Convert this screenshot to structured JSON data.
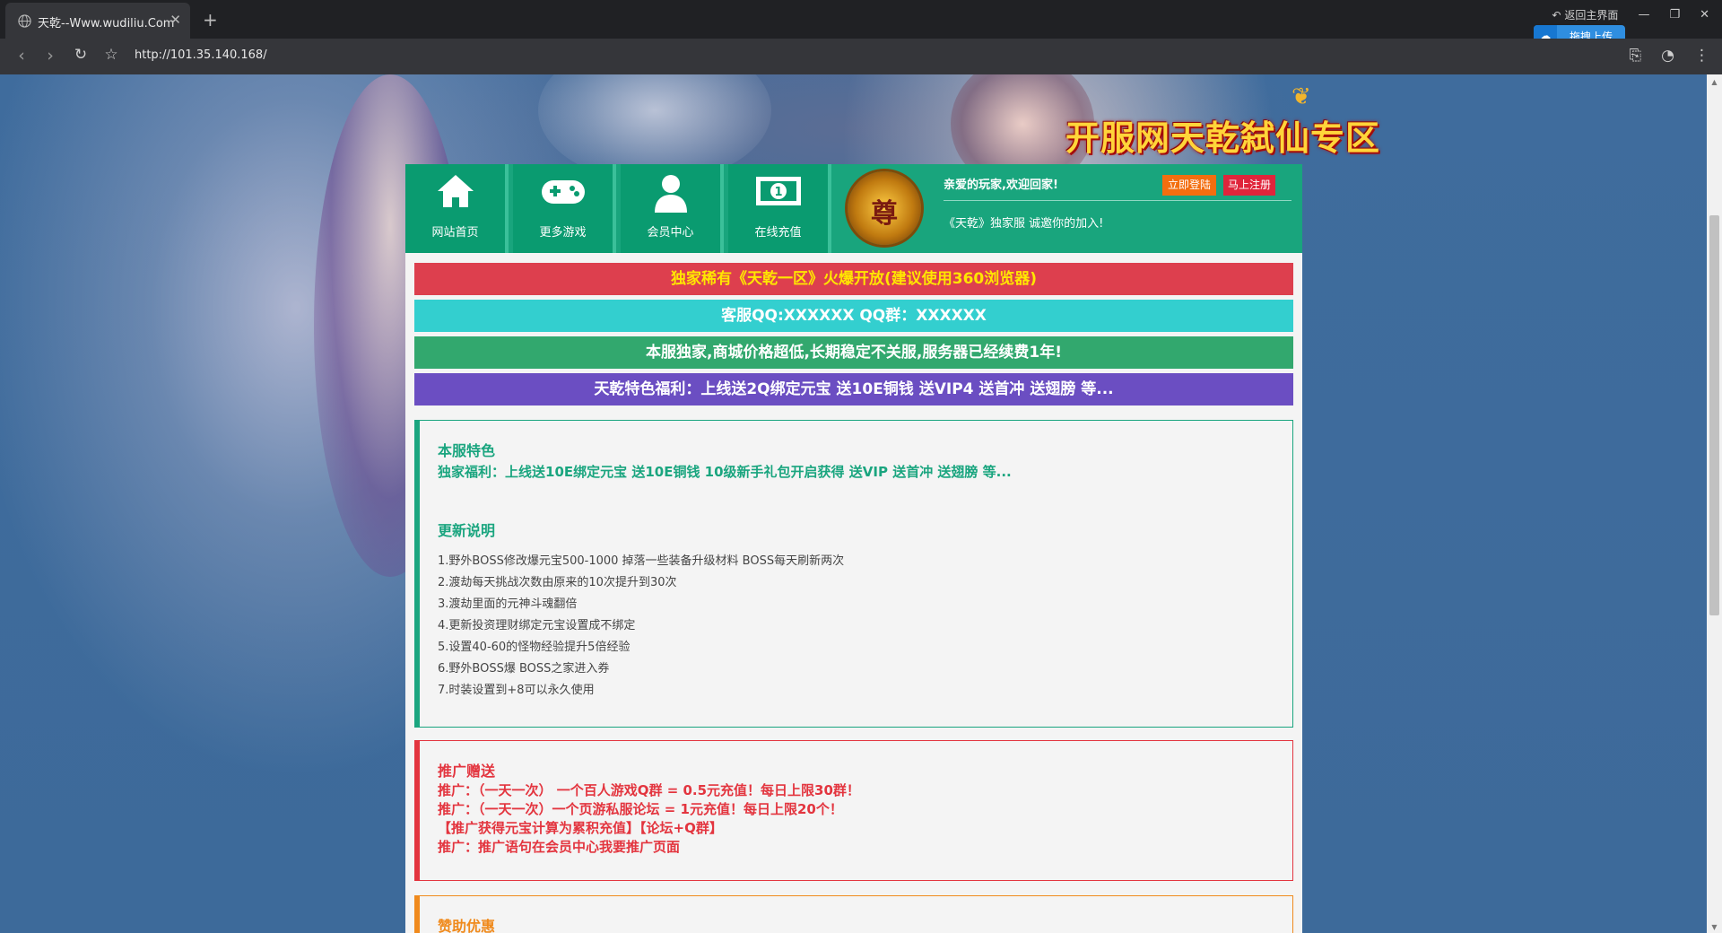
{
  "browser": {
    "tab_title": "天乾--Www.wudiliu.Com",
    "url": "http://101.35.140.168/",
    "back_main": "返回主界面",
    "upload_label": "拖拽上传"
  },
  "banner": {
    "title": "开服网天乾弑仙专区"
  },
  "nav": {
    "items": [
      {
        "label": "网站首页",
        "icon": "home-icon"
      },
      {
        "label": "更多游戏",
        "icon": "gamepad-icon"
      },
      {
        "label": "会员中心",
        "icon": "user-icon"
      },
      {
        "label": "在线充值",
        "icon": "money-icon"
      }
    ],
    "logo_char": "尊",
    "welcome": "亲爱的玩家,欢迎回家!",
    "login": "立即登陆",
    "register": "马上注册",
    "invite": "《天乾》独家服 诚邀你的加入!"
  },
  "bars": [
    {
      "text": "独家稀有《天乾一区》火爆开放(建议使用360浏览器)",
      "bg": "#dd3f4e",
      "color": "#ffe600"
    },
    {
      "text": "客服QQ:XXXXXX QQ群：XXXXXX",
      "bg": "#33cfcf",
      "color": "#ffffff"
    },
    {
      "text": "本服独家,商城价格超低,长期稳定不关服,服务器已经续费1年!",
      "bg": "#32a86e",
      "color": "#ffffff"
    },
    {
      "text": "天乾特色福利：上线送2Q绑定元宝 送10E铜钱 送VIP4 送首冲 送翅膀 等...",
      "bg": "#6b4ec2",
      "color": "#ffffff"
    }
  ],
  "features": {
    "heading": "本服特色",
    "benefit": "独家福利：上线送10E绑定元宝 送10E铜钱 10级新手礼包开启获得 送VIP 送首冲 送翅膀 等...",
    "update_heading": "更新说明",
    "updates": [
      "1.野外BOSS修改爆元宝500-1000 掉落一些装备升级材料 BOSS每天刷新两次",
      "2.渡劫每天挑战次数由原来的10次提升到30次",
      "3.渡劫里面的元神斗魂翻倍",
      "4.更新投资理财绑定元宝设置成不绑定",
      "5.设置40-60的怪物经验提升5倍经验",
      "6.野外BOSS爆 BOSS之家进入券",
      "7.时装设置到+8可以永久使用"
    ],
    "color": "#1aa57f"
  },
  "promo": {
    "heading": "推广赠送",
    "lines": [
      "推广：（一天一次） 一个百人游戏Q群 = 0.5元充值！每日上限30群！",
      "推广：（一天一次）一个页游私服论坛 = 1元充值！每日上限20个！",
      "【推广获得元宝计算为累积充值】【论坛+Q群】",
      "推广：推广语句在会员中心我要推广页面"
    ],
    "color": "#e3353f"
  },
  "sponsor": {
    "heading": "赞助优惠",
    "color": "#f08a1c"
  }
}
